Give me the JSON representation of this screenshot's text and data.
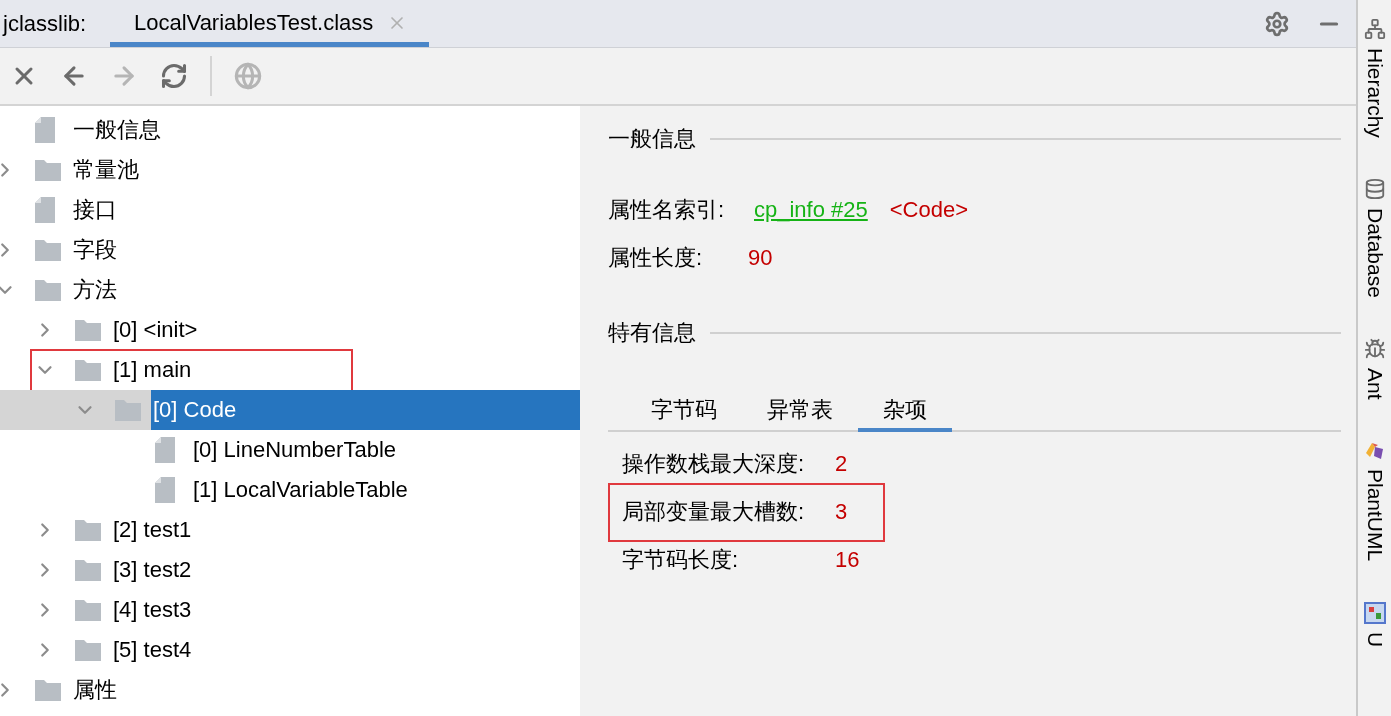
{
  "header": {
    "title": "jclasslib:",
    "tabs": [
      {
        "label": "LocalVariablesTest.class",
        "selected": true
      }
    ]
  },
  "toolbar": [
    {
      "kind": "close",
      "disabled": false
    },
    {
      "kind": "back",
      "disabled": false
    },
    {
      "kind": "forward",
      "disabled": true
    },
    {
      "kind": "refresh",
      "disabled": false
    },
    {
      "kind": "web",
      "disabled": true
    }
  ],
  "tree": [
    {
      "label": "一般信息",
      "kind": "file",
      "selected": false,
      "highlighted": false
    },
    {
      "label": "常量池",
      "kind": "folder",
      "expanded": false,
      "selected": false,
      "highlighted": false
    },
    {
      "label": "接口",
      "kind": "file",
      "selected": false,
      "highlighted": false
    },
    {
      "label": "字段",
      "kind": "folder",
      "expanded": false,
      "selected": false,
      "highlighted": false
    },
    {
      "label": "方法",
      "kind": "folder",
      "expanded": true,
      "selected": false,
      "highlighted": false,
      "children": [
        {
          "label": "[0] <init>",
          "kind": "folder",
          "expanded": false,
          "selected": false,
          "highlighted": false
        },
        {
          "label": "[1] main",
          "kind": "folder",
          "expanded": true,
          "selected": false,
          "highlighted": true,
          "children": [
            {
              "label": "[0] Code",
              "kind": "folder",
              "expanded": true,
              "selected": true,
              "highlighted": false,
              "children": [
                {
                  "label": "[0] LineNumberTable",
                  "kind": "file",
                  "selected": false,
                  "highlighted": false
                },
                {
                  "label": "[1] LocalVariableTable",
                  "kind": "file",
                  "selected": false,
                  "highlighted": false
                }
              ]
            }
          ]
        },
        {
          "label": "[2] test1",
          "kind": "folder",
          "expanded": false,
          "selected": false,
          "highlighted": false
        },
        {
          "label": "[3] test2",
          "kind": "folder",
          "expanded": false,
          "selected": false,
          "highlighted": false
        },
        {
          "label": "[4] test3",
          "kind": "folder",
          "expanded": false,
          "selected": false,
          "highlighted": false
        },
        {
          "label": "[5] test4",
          "kind": "folder",
          "expanded": false,
          "selected": false,
          "highlighted": false
        }
      ]
    },
    {
      "label": "属性",
      "kind": "folder",
      "expanded": false,
      "selected": false,
      "highlighted": false
    }
  ],
  "details": {
    "general": {
      "title": "一般信息",
      "name_index": {
        "label": "属性名索引:",
        "link": "cp_info #25",
        "value": "<Code>"
      },
      "length": {
        "label": "属性长度:",
        "value": "90"
      }
    },
    "specific": {
      "title": "特有信息",
      "tabs": [
        {
          "label": "字节码",
          "selected": false
        },
        {
          "label": "异常表",
          "selected": false
        },
        {
          "label": "杂项",
          "selected": true
        }
      ],
      "rows": [
        {
          "label": "操作数栈最大深度:",
          "value": "2",
          "highlighted": false
        },
        {
          "label": "局部变量最大槽数:",
          "value": "3",
          "highlighted": true
        },
        {
          "label": "字节码长度:",
          "value": "16",
          "highlighted": false
        }
      ]
    }
  },
  "side_panel": [
    {
      "label": "Hierarchy",
      "kind": "hierarchy"
    },
    {
      "label": "Database",
      "kind": "database"
    },
    {
      "label": "Ant",
      "kind": "ant"
    },
    {
      "label": "PlantUML",
      "kind": "plantuml"
    },
    {
      "label": "U",
      "kind": "uml"
    }
  ]
}
